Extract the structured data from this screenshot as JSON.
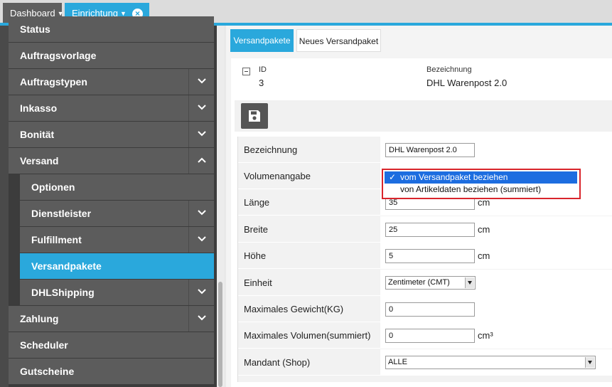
{
  "top_tabs": [
    {
      "label": "Dashboard"
    },
    {
      "label": "Einrichtung"
    }
  ],
  "sidebar": {
    "items": [
      {
        "label": "Status",
        "expandable": false
      },
      {
        "label": "Auftragsvorlage",
        "expandable": false
      },
      {
        "label": "Auftragstypen",
        "expandable": true
      },
      {
        "label": "Inkasso",
        "expandable": true
      },
      {
        "label": "Bonität",
        "expandable": true
      },
      {
        "label": "Versand",
        "expandable": true,
        "expanded": true
      },
      {
        "label": "Optionen",
        "expandable": false
      },
      {
        "label": "Dienstleister",
        "expandable": true
      },
      {
        "label": "Fulfillment",
        "expandable": true
      },
      {
        "label": "Versandpakete",
        "expandable": false,
        "active": true
      },
      {
        "label": "DHLShipping",
        "expandable": true
      },
      {
        "label": "Zahlung",
        "expandable": true
      },
      {
        "label": "Scheduler",
        "expandable": false
      },
      {
        "label": "Gutscheine",
        "expandable": false
      }
    ]
  },
  "tabs": {
    "versandpakete": "Versandpakete",
    "neues": "Neues Versandpaket"
  },
  "header": {
    "id_label": "ID",
    "id_value": "3",
    "bez_label": "Bezeichnung",
    "bez_value": "DHL Warenpost 2.0"
  },
  "form": {
    "bezeichnung": {
      "label": "Bezeichnung",
      "value": "DHL Warenpost 2.0"
    },
    "volumenangabe": {
      "label": "Volumenangabe"
    },
    "laenge": {
      "label": "Länge",
      "value": "35",
      "unit": "cm"
    },
    "breite": {
      "label": "Breite",
      "value": "25",
      "unit": "cm"
    },
    "hoehe": {
      "label": "Höhe",
      "value": "5",
      "unit": "cm"
    },
    "einheit": {
      "label": "Einheit",
      "value": "Zentimeter (CMT)"
    },
    "gewicht": {
      "label": "Maximales Gewicht(KG)",
      "value": "0"
    },
    "volumen": {
      "label": "Maximales Volumen(summiert)",
      "value": "0",
      "unit": "cm³"
    },
    "mandant": {
      "label": "Mandant (Shop)",
      "value": "ALLE"
    }
  },
  "dropdown": {
    "options": [
      "vom Versandpaket beziehen",
      "von Artikeldaten beziehen (summiert)"
    ],
    "selected_index": 0,
    "check": "✓"
  },
  "colors": {
    "accent": "#2aa8dc",
    "sidebar_item": "#5c5c5c",
    "highlight_frame": "#d9252c",
    "selected_option": "#1d6de0"
  }
}
